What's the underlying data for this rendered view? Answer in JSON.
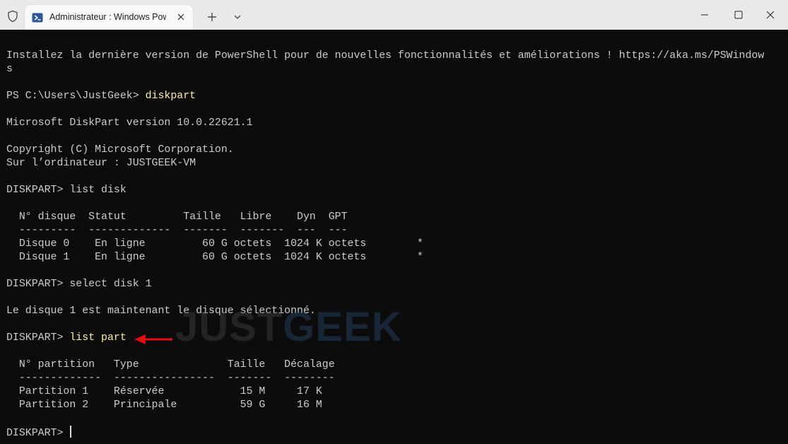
{
  "tab": {
    "title": "Administrateur : Windows PowerShell"
  },
  "icons": {
    "shield": "shield-icon",
    "powershell": "powershell-icon",
    "close_tab": "close-icon",
    "new_tab": "plus-icon",
    "dropdown": "chevron-down-icon",
    "minimize": "minimize-icon",
    "maximize": "maximize-icon",
    "close_window": "close-icon"
  },
  "watermark": {
    "part1": "JUST",
    "part2": "GEEK"
  },
  "terminal": {
    "lines": [
      "Installez la dernière version de PowerShell pour de nouvelles fonctionnalités et améliorations ! https://aka.ms/PSWindow",
      "s",
      "",
      "PS C:\\Users\\JustGeek> diskpart",
      "",
      "Microsoft DiskPart version 10.0.22621.1",
      "",
      "Copyright (C) Microsoft Corporation.",
      "Sur l’ordinateur : JUSTGEEK-VM",
      "",
      "DISKPART> list disk",
      "",
      "  N° disque  Statut         Taille   Libre    Dyn  GPT",
      "  ---------  -------------  -------  -------  ---  ---",
      "  Disque 0    En ligne         60 G octets  1024 K octets        *",
      "  Disque 1    En ligne         60 G octets  1024 K octets        *",
      "",
      "DISKPART> select disk 1",
      "",
      "Le disque 1 est maintenant le disque sélectionné.",
      "",
      "DISKPART> list part",
      "",
      "  N° partition   Type              Taille   Décalage",
      "  -------------  ----------------  -------  --------",
      "  Partition 1    Réservée            15 M     17 K",
      "  Partition 2    Principale          59 G     16 M",
      "",
      "DISKPART> "
    ]
  },
  "colors": {
    "background": "#0c0c0c",
    "text": "#cccccc",
    "command_highlight": "#f9f1a5",
    "arrow": "#e01010"
  }
}
